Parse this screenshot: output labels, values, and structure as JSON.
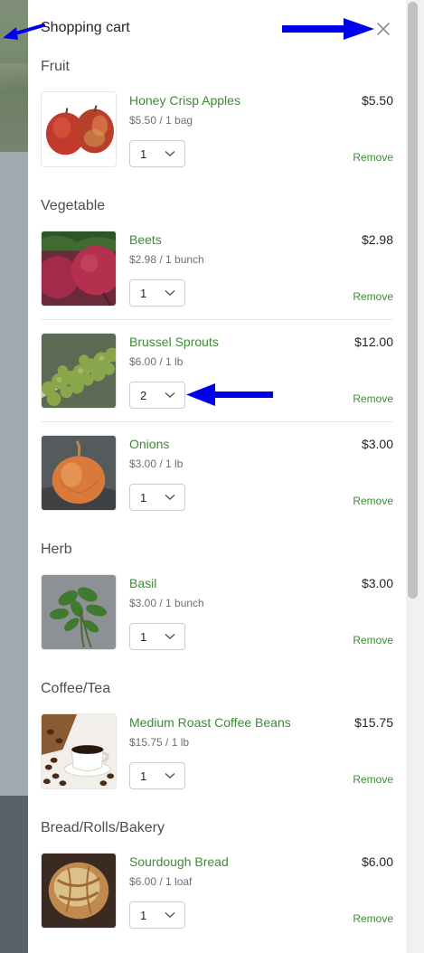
{
  "cart": {
    "title": "Shopping cart",
    "close_icon": "close-icon",
    "remove_label": "Remove",
    "sections": [
      {
        "name": "Fruit",
        "items": [
          {
            "name": "Honey Crisp Apples",
            "unit_price": "$5.50 / 1 bag",
            "price": "$5.50",
            "qty": "1",
            "image": "apples"
          }
        ]
      },
      {
        "name": "Vegetable",
        "items": [
          {
            "name": "Beets",
            "unit_price": "$2.98 / 1 bunch",
            "price": "$2.98",
            "qty": "1",
            "image": "beets"
          },
          {
            "name": "Brussel Sprouts",
            "unit_price": "$6.00 / 1 lb",
            "price": "$12.00",
            "qty": "2",
            "image": "sprouts"
          },
          {
            "name": "Onions",
            "unit_price": "$3.00 / 1 lb",
            "price": "$3.00",
            "qty": "1",
            "image": "onion"
          }
        ]
      },
      {
        "name": "Herb",
        "items": [
          {
            "name": "Basil",
            "unit_price": "$3.00 / 1 bunch",
            "price": "$3.00",
            "qty": "1",
            "image": "basil"
          }
        ]
      },
      {
        "name": "Coffee/Tea",
        "items": [
          {
            "name": "Medium Roast Coffee Beans",
            "unit_price": "$15.75 / 1 lb",
            "price": "$15.75",
            "qty": "1",
            "image": "coffee"
          }
        ]
      },
      {
        "name": "Bread/Rolls/Bakery",
        "items": [
          {
            "name": "Sourdough Bread",
            "unit_price": "$6.00 / 1 loaf",
            "price": "$6.00",
            "qty": "1",
            "image": "bread"
          }
        ]
      }
    ]
  },
  "colors": {
    "accent_green": "#3d8b37",
    "annotation_arrow": "#0000ee"
  }
}
